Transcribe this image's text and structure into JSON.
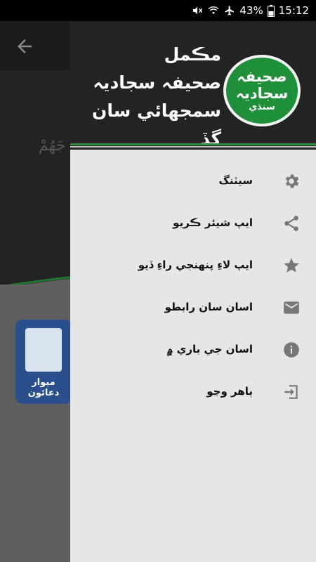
{
  "status_bar": {
    "battery": "43%",
    "time": "15:12",
    "icons": [
      "mute-icon",
      "wifi-icon",
      "airplane-icon",
      "battery-icon"
    ]
  },
  "background": {
    "arabic_text": "جَهُمْ",
    "logo_text": "ميوار دعائون"
  },
  "drawer": {
    "header": {
      "title_lines": [
        "مڪمل",
        "صحيفہ سجاديہ",
        "سمجھائي سان گڏ"
      ],
      "badge_lines": [
        "صحيفہ",
        "سجاديہ",
        "سنڌي"
      ]
    },
    "menu": [
      {
        "label": "سيٽنگ",
        "icon": "gear-icon"
      },
      {
        "label": "ايپ شيئر ڪريو",
        "icon": "share-icon"
      },
      {
        "label": "ايپ لاءِ پنهنجي راءِ ڏيو",
        "icon": "star-icon"
      },
      {
        "label": "اسان سان رابطو",
        "icon": "email-icon"
      },
      {
        "label": "اسان جي باري ۾",
        "icon": "info-icon"
      },
      {
        "label": "ٻاهر وڃو",
        "icon": "exit-icon"
      }
    ]
  },
  "colors": {
    "accent_green": "#1f8f3a",
    "drawer_bg": "#e6e6e6",
    "header_bg": "#232323",
    "icon_grey": "#777777"
  }
}
